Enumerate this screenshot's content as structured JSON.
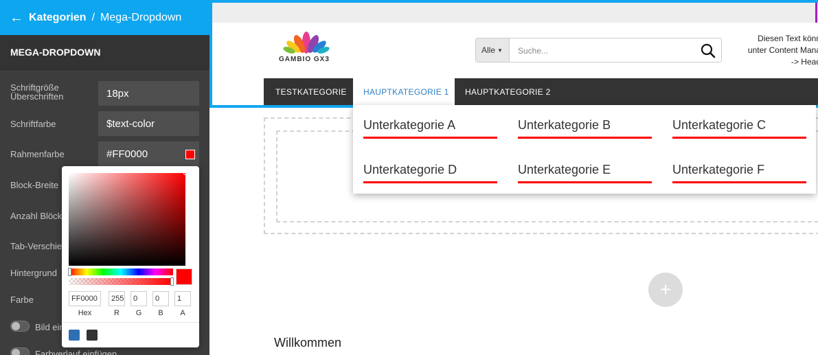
{
  "topbar": {
    "back_label": "Kategorien",
    "separator": "/",
    "current": "Mega-Dropdown"
  },
  "section": {
    "title": "MEGA-DROPDOWN"
  },
  "settings": [
    {
      "label": "Schriftgröße Überschriften",
      "value": "18px"
    },
    {
      "label": "Schriftfarbe",
      "value": "$text-color"
    },
    {
      "label": "Rahmenfarbe",
      "value": "#FF0000"
    },
    {
      "label": "Block-Breite"
    },
    {
      "label": "Anzahl Blöcke"
    },
    {
      "label": "Tab-Verschiebung"
    },
    {
      "label": "Hintergrund"
    },
    {
      "label": "Farbe"
    }
  ],
  "toggles": [
    {
      "label": "Bild einfügen"
    },
    {
      "label": "Farbverlauf einfügen"
    }
  ],
  "color_picker": {
    "hex": "FF0000",
    "r": "255",
    "g": "0",
    "b": "0",
    "a": "1",
    "labels": {
      "hex": "Hex",
      "r": "R",
      "g": "G",
      "b": "B",
      "a": "A"
    },
    "current_color": "#ff0000",
    "presets": [
      "#2f6fb4",
      "#333333"
    ]
  },
  "preview": {
    "logo_text": "GAMBIO GX3",
    "search": {
      "category": "Alle",
      "placeholder": "Suche..."
    },
    "header_note": [
      "Diesen Text könn",
      "unter Content Mana",
      "-> Head"
    ],
    "nav": [
      "TESTKATEGORIE",
      "HAUPTKATEGORIE 1",
      "HAUPTKATEGORIE 2"
    ],
    "mega_items": [
      "Unterkategorie A",
      "Unterkategorie B",
      "Unterkategorie C",
      "Unterkategorie D",
      "Unterkategorie E",
      "Unterkategorie F"
    ],
    "add_symbol": "+",
    "welcome": "Willkommen"
  },
  "colors": {
    "accent": "#0ea6ee",
    "panel": "#3d3d3d",
    "border_red": "#ff0000",
    "link": "#2f7ec3"
  }
}
